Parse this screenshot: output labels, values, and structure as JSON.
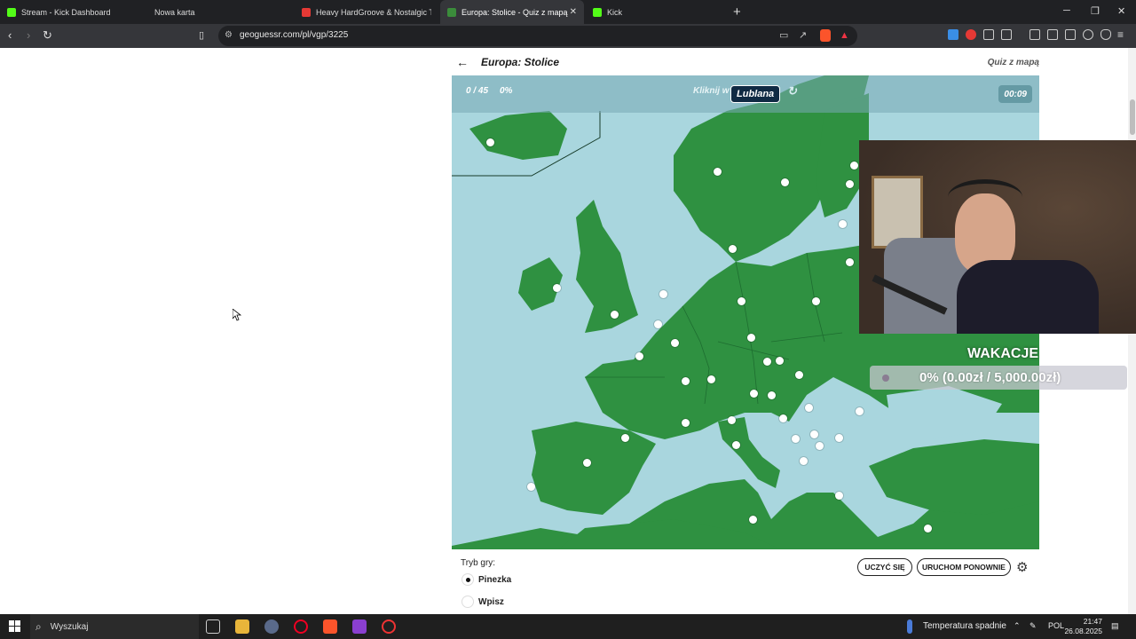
{
  "browser": {
    "tabs": [
      {
        "title": "Stream - Kick Dashboard",
        "icon": "kick-icon",
        "active": false
      },
      {
        "title": "Nowa karta",
        "icon": "",
        "active": false
      },
      {
        "title": "Heavy HardGroove & Nostalgic Tran",
        "icon": "youtube-icon",
        "active": false
      },
      {
        "title": "Europa: Stolice - Quiz z mapą - S",
        "icon": "geoguessr-icon",
        "active": true
      },
      {
        "title": "Kick",
        "icon": "kick-icon",
        "active": false
      }
    ],
    "url": "geoguessr.com/pl/vgp/3225"
  },
  "quiz": {
    "title": "Europa: Stolice",
    "type_label": "Quiz z mapą",
    "progress": "0 / 45",
    "percent": "0%",
    "prompt": "Kliknij w",
    "target": "Lublana",
    "timer": "00:09"
  },
  "overlay": {
    "goal_title": "WAKACJE",
    "goal_progress": "0% (0.00zł / 5,000.00zł)"
  },
  "mode": {
    "label": "Tryb gry:",
    "options": [
      {
        "label": "Pinezka",
        "selected": true
      },
      {
        "label": "Wpisz",
        "selected": false
      }
    ],
    "learn_button": "UCZYĆ SIĘ",
    "restart_button": "URUCHOM PONOWNIE"
  },
  "taskbar": {
    "search_placeholder": "Wyszukaj",
    "weather": "Temperatura spadnie",
    "language": "POL",
    "time": "21:47",
    "date": "26.08.2025"
  },
  "colors": {
    "land": "#2f9141",
    "sea": "#a9d6de",
    "target_bg": "#102a43"
  }
}
